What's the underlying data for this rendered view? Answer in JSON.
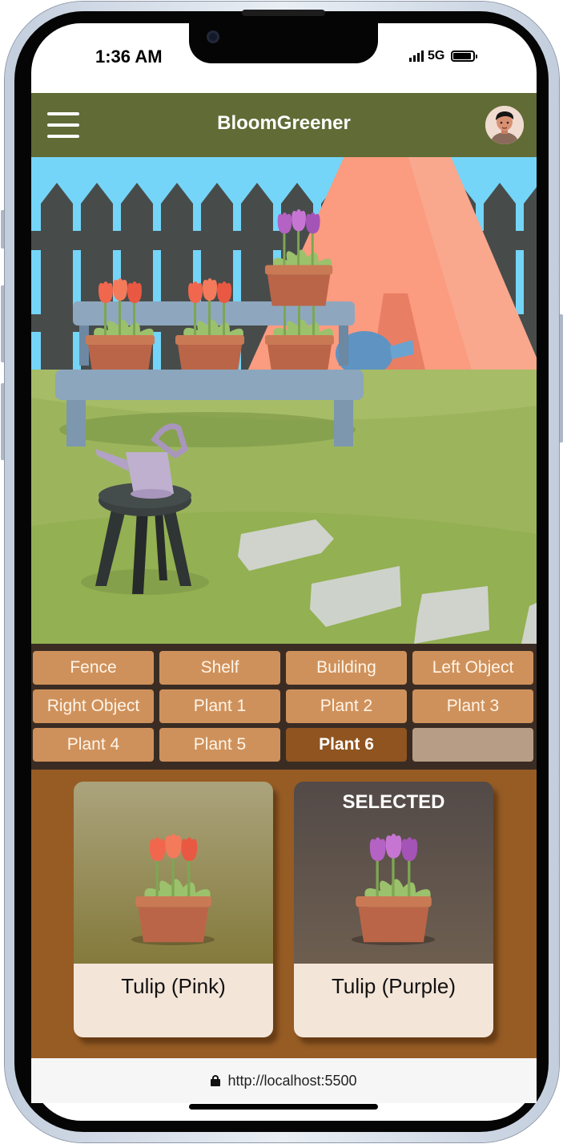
{
  "status_bar": {
    "time": "1:36 AM",
    "network": "5G"
  },
  "header": {
    "title": "BloomGreener",
    "menu_icon": "hamburger-icon",
    "avatar_icon": "user-avatar"
  },
  "categories": [
    {
      "label": "Fence"
    },
    {
      "label": "Shelf"
    },
    {
      "label": "Building"
    },
    {
      "label": "Left Object"
    },
    {
      "label": "Right Object"
    },
    {
      "label": "Plant 1"
    },
    {
      "label": "Plant 2"
    },
    {
      "label": "Plant 3"
    },
    {
      "label": "Plant 4"
    },
    {
      "label": "Plant 5"
    },
    {
      "label": "Plant 6",
      "active": true
    },
    {
      "label": "",
      "empty": true
    }
  ],
  "options": [
    {
      "name": "Tulip (Pink)",
      "selected": false
    },
    {
      "name": "Tulip (Purple)",
      "selected": true,
      "badge": "SELECTED"
    }
  ],
  "browser": {
    "url": "http://localhost:5500"
  },
  "colors": {
    "header": "#606b36",
    "tab": "#cf915b",
    "tab_active": "#8f541f",
    "cards_background": "#965c24",
    "card_caption": "#f4e5d9"
  }
}
